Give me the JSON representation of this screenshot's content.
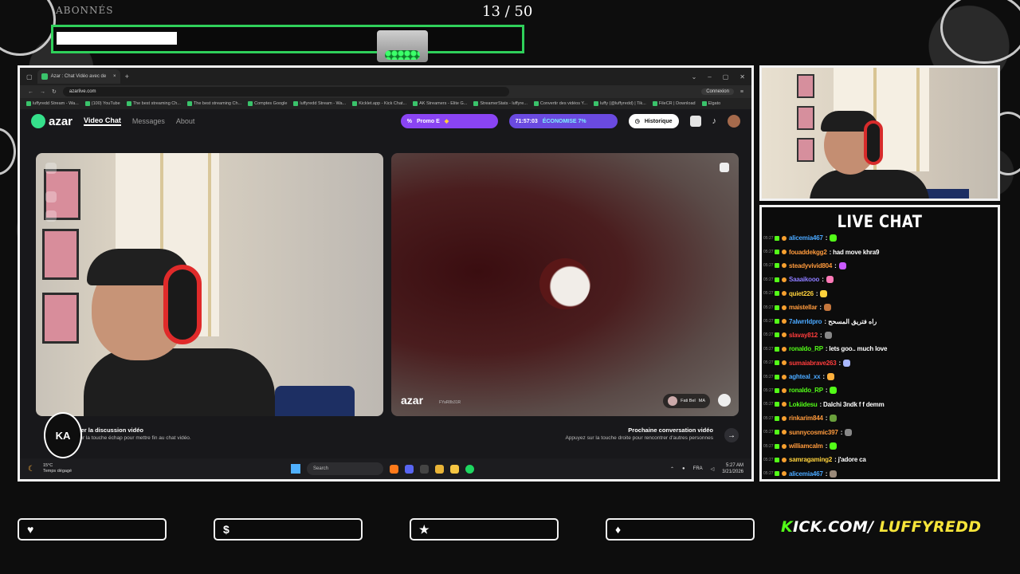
{
  "sub_goal": {
    "label": "ABONNÉS",
    "count": "13",
    "goal": "/ 50",
    "progress": 0.26,
    "color": "#2fd05a"
  },
  "browser": {
    "tab_title": "Azar : Chat Vidéo avec de",
    "url": "azarlive.com",
    "connexion": "Connexion",
    "bookmarks": [
      "luffyredd Stream - Wa...",
      "(100) YouTube",
      "The best streaming Ch...",
      "The best streaming Ch...",
      "Comptes Google",
      "luffyredd Stream - Wa...",
      "Kicklet.app - Kick Chat...",
      "AK Streamers - Elite G...",
      "StreamerStats - luffyre...",
      "Convertir des vidéos Y...",
      "luffy (@luffyredd) | Tik...",
      "FileCR | Download",
      "Elgato"
    ]
  },
  "azar": {
    "logo": "azar",
    "nav": [
      "Video Chat",
      "Messages",
      "About"
    ],
    "promo": "Promo E",
    "timer": "71:57:03",
    "economise": "ÉCONOMISE 7%",
    "historique": "Historique",
    "remote_watermark": "azar",
    "remote_id": "FYaR8b31R",
    "remote_user": "Fati Bel",
    "remote_country": "MA",
    "end_title": "her la discussion vidéo",
    "end_sub": "sur la touche échap pour mettre fin au chat vidéo.",
    "next_title": "Prochaine conversation vidéo",
    "next_sub": "Appuyez sur la touche droite pour rencontrer d'autres personnes",
    "ka_logo": "KA"
  },
  "taskbar": {
    "temp": "15°C",
    "weather": "Temps dégagé",
    "search": "Search",
    "lang": "FRA",
    "time": "5:27 AM",
    "date": "3/21/2026"
  },
  "chat": {
    "title": "LIVE CHAT",
    "messages": [
      {
        "time": "05:27",
        "user": "alicemia467",
        "text": ":",
        "color": "#4aa8ff",
        "emote": "#53fc18"
      },
      {
        "time": "05:27",
        "user": "fouaddekgg2",
        "text": ": had move khra9",
        "color": "#ff9a3c",
        "emote": ""
      },
      {
        "time": "05:27",
        "user": "steadyvivid804",
        "text": ":",
        "color": "#ff9a3c",
        "emote": "#c95aff"
      },
      {
        "time": "05:27",
        "user": "Saaaikooo",
        "text": ":",
        "color": "#8c7bff",
        "emote": "#ff7ab8"
      },
      {
        "time": "05:27",
        "user": "quiet226",
        "text": ":",
        "color": "#ffd23c",
        "emote": "#ffd23c"
      },
      {
        "time": "05:27",
        "user": "maistellar",
        "text": ":",
        "color": "#ff9a3c",
        "emote": "#c4763c"
      },
      {
        "time": "05:27",
        "user": "7alwrrldpro",
        "text": ": راه فتريق المسحح",
        "color": "#4aa8ff",
        "emote": ""
      },
      {
        "time": "05:27",
        "user": "slavay812",
        "text": ":",
        "color": "#ff3c3c",
        "emote": "#888888"
      },
      {
        "time": "05:27",
        "user": "ronaldo_RP",
        "text": ": lets goo.. much love",
        "color": "#53fc18",
        "emote": ""
      },
      {
        "time": "05:27",
        "user": "sumaiabrave263",
        "text": ":",
        "color": "#ff3c3c",
        "emote": "#a9b8ff"
      },
      {
        "time": "05:27",
        "user": "aghteal_xx",
        "text": ":",
        "color": "#4aa8ff",
        "emote": "#ffb03c"
      },
      {
        "time": "05:27",
        "user": "ronaldo_RP",
        "text": ":",
        "color": "#53fc18",
        "emote": "#53fc18"
      },
      {
        "time": "05:27",
        "user": "Lokiidesu",
        "text": ": Dalchi 3ndk f f demm",
        "color": "#53fc18",
        "emote": ""
      },
      {
        "time": "05:27",
        "user": "rinkarim844",
        "text": ":",
        "color": "#ff9a3c",
        "emote": "#6aa03c"
      },
      {
        "time": "05:27",
        "user": "sunnycosmic397",
        "text": ":",
        "color": "#ff9a3c",
        "emote": "#888888"
      },
      {
        "time": "05:27",
        "user": "williamcalm",
        "text": ":",
        "color": "#ff9a3c",
        "emote": "#53fc18"
      },
      {
        "time": "05:27",
        "user": "samragaming2",
        "text": ": j'adore ca",
        "color": "#ffd23c",
        "emote": ""
      },
      {
        "time": "05:27",
        "user": "alicemia467",
        "text": ":",
        "color": "#4aa8ff",
        "emote": "#9a8a7a"
      }
    ]
  },
  "bottom_buttons": [
    {
      "icon": "heart-icon",
      "glyph": "♥"
    },
    {
      "icon": "dollar-icon",
      "glyph": "$"
    },
    {
      "icon": "star-icon",
      "glyph": "★"
    },
    {
      "icon": "drop-icon",
      "glyph": "♦"
    }
  ],
  "kick": {
    "k": "K",
    "domain": "ICK.COM/",
    "channel": "LUFFYREDD"
  }
}
